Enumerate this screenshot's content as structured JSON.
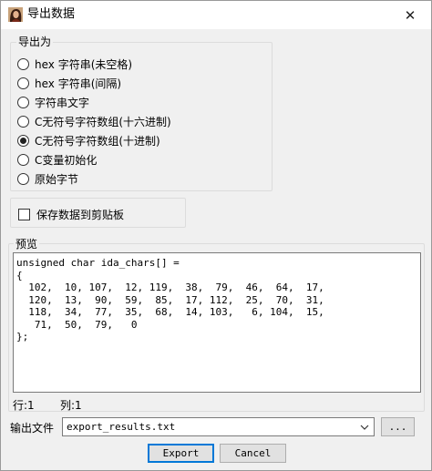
{
  "window": {
    "title": "导出数据",
    "close_glyph": "✕",
    "icon": "user-avatar-icon"
  },
  "export_as": {
    "legend": "导出为",
    "options": [
      {
        "label": "hex 字符串(未空格)",
        "checked": false
      },
      {
        "label": "hex 字符串(间隔)",
        "checked": false
      },
      {
        "label": "字符串文字",
        "checked": false
      },
      {
        "label": "C无符号字符数组(十六进制)",
        "checked": false
      },
      {
        "label": "C无符号字符数组(十进制)",
        "checked": true
      },
      {
        "label": "C变量初始化",
        "checked": false
      },
      {
        "label": "原始字节",
        "checked": false
      }
    ]
  },
  "clipboard": {
    "label": "保存数据到剪贴板",
    "checked": false
  },
  "preview": {
    "label": "预览",
    "lines": [
      "unsigned char ida_chars[] =",
      "{",
      "  102,  10, 107,  12, 119,  38,  79,  46,  64,  17,",
      "  120,  13,  90,  59,  85,  17, 112,  25,  70,  31,",
      "  118,  34,  77,  35,  68,  14, 103,   6, 104,  15,",
      "   71,  50,  79,   0",
      "};"
    ]
  },
  "status": {
    "row": "行:1",
    "col": "列:1"
  },
  "output": {
    "label": "输出文件",
    "value": "export_results.txt",
    "browse_label": "..."
  },
  "buttons": {
    "export": "Export",
    "cancel": "Cancel"
  },
  "colors": {
    "default_button_border": "#0078d7",
    "title_bar": "#ffffff",
    "dialog_bg": "#f0f0f0"
  }
}
